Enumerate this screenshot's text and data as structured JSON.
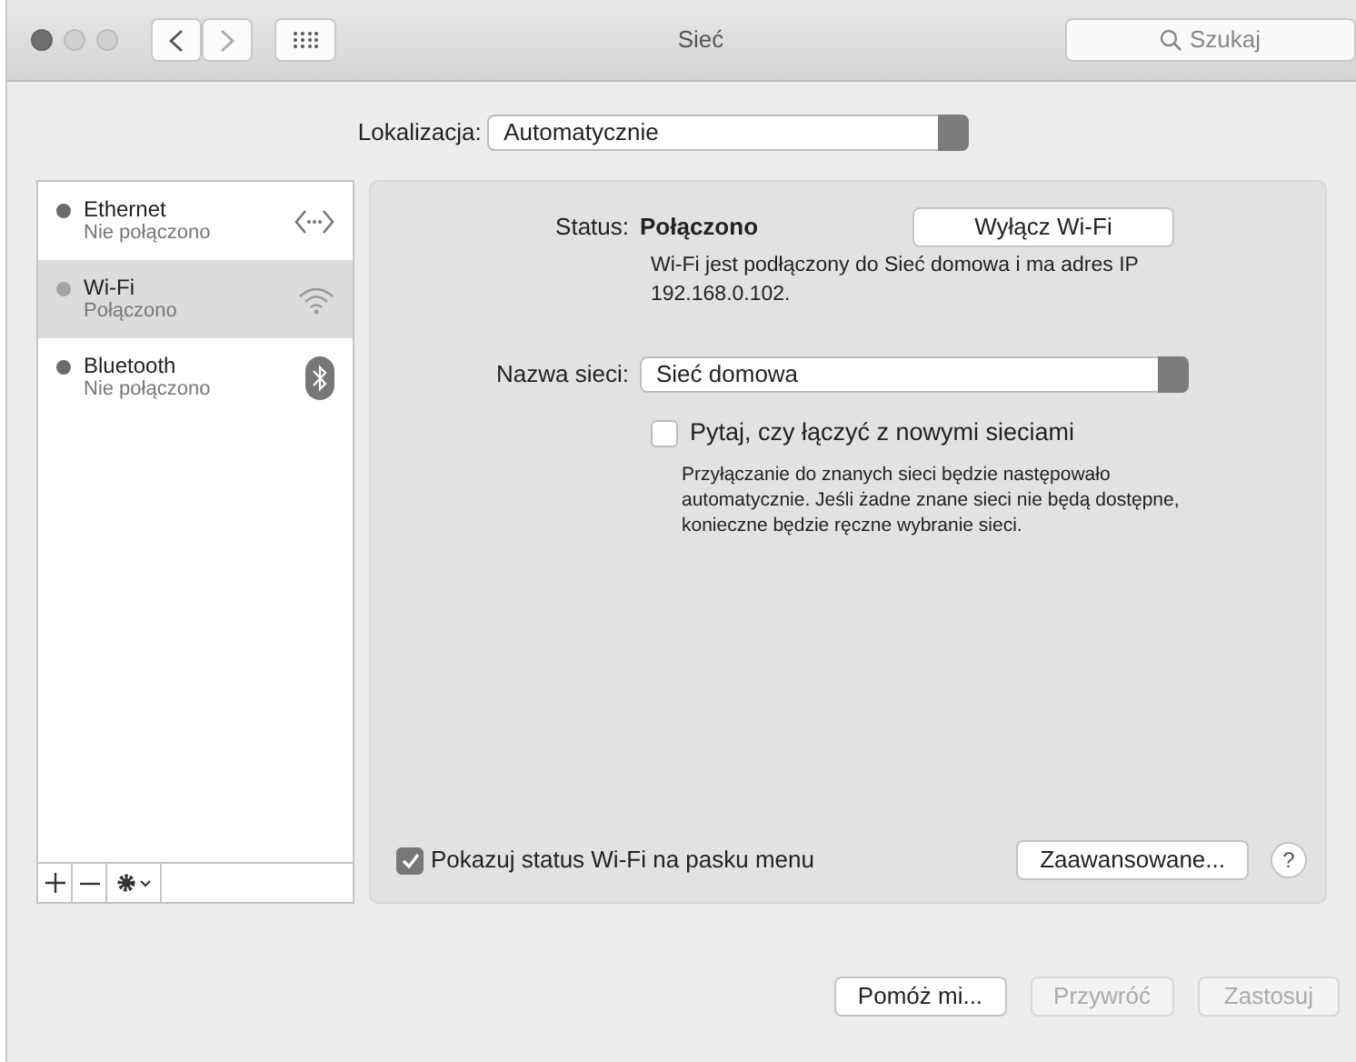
{
  "window": {
    "title": "Sieć",
    "search": {
      "placeholder": "Szukaj"
    }
  },
  "location": {
    "label": "Lokalizacja:",
    "value": "Automatycznie"
  },
  "services": [
    {
      "name": "Ethernet",
      "status": "Nie połączono",
      "kind": "ethernet",
      "selected": false,
      "color": "#6b6b6b"
    },
    {
      "name": "Wi-Fi",
      "status": "Połączono",
      "kind": "wifi",
      "selected": true,
      "color": "#a3a3a3"
    },
    {
      "name": "Bluetooth",
      "status": "Nie połączono",
      "kind": "bluetooth",
      "selected": false,
      "color": "#6b6b6b"
    }
  ],
  "detail": {
    "status_label": "Status:",
    "status_value": "Połączono",
    "toggle_button": "Wyłącz Wi-Fi",
    "status_text": "Wi-Fi jest podłączony do Sieć domowa i ma adres IP 192.168.0.102.",
    "network_label": "Nazwa sieci:",
    "network_value": "Sieć domowa",
    "ask_checkbox": {
      "label": "Pytaj, czy łączyć z nowymi sieciami",
      "checked": false
    },
    "ask_hint": "Przyłączanie do znanych sieci będzie następowało automatycznie. Jeśli żadne znane sieci nie będą dostępne, konieczne będzie ręczne wybranie sieci.",
    "menu_checkbox": {
      "label": "Pokazuj status Wi-Fi na pasku menu",
      "checked": true
    },
    "advanced_button": "Zaawansowane...",
    "help_button": "?"
  },
  "buttons": [
    {
      "label": "Pomóż mi...",
      "disabled": false
    },
    {
      "label": "Przywróć",
      "disabled": true
    },
    {
      "label": "Zastosuj",
      "disabled": true
    }
  ]
}
